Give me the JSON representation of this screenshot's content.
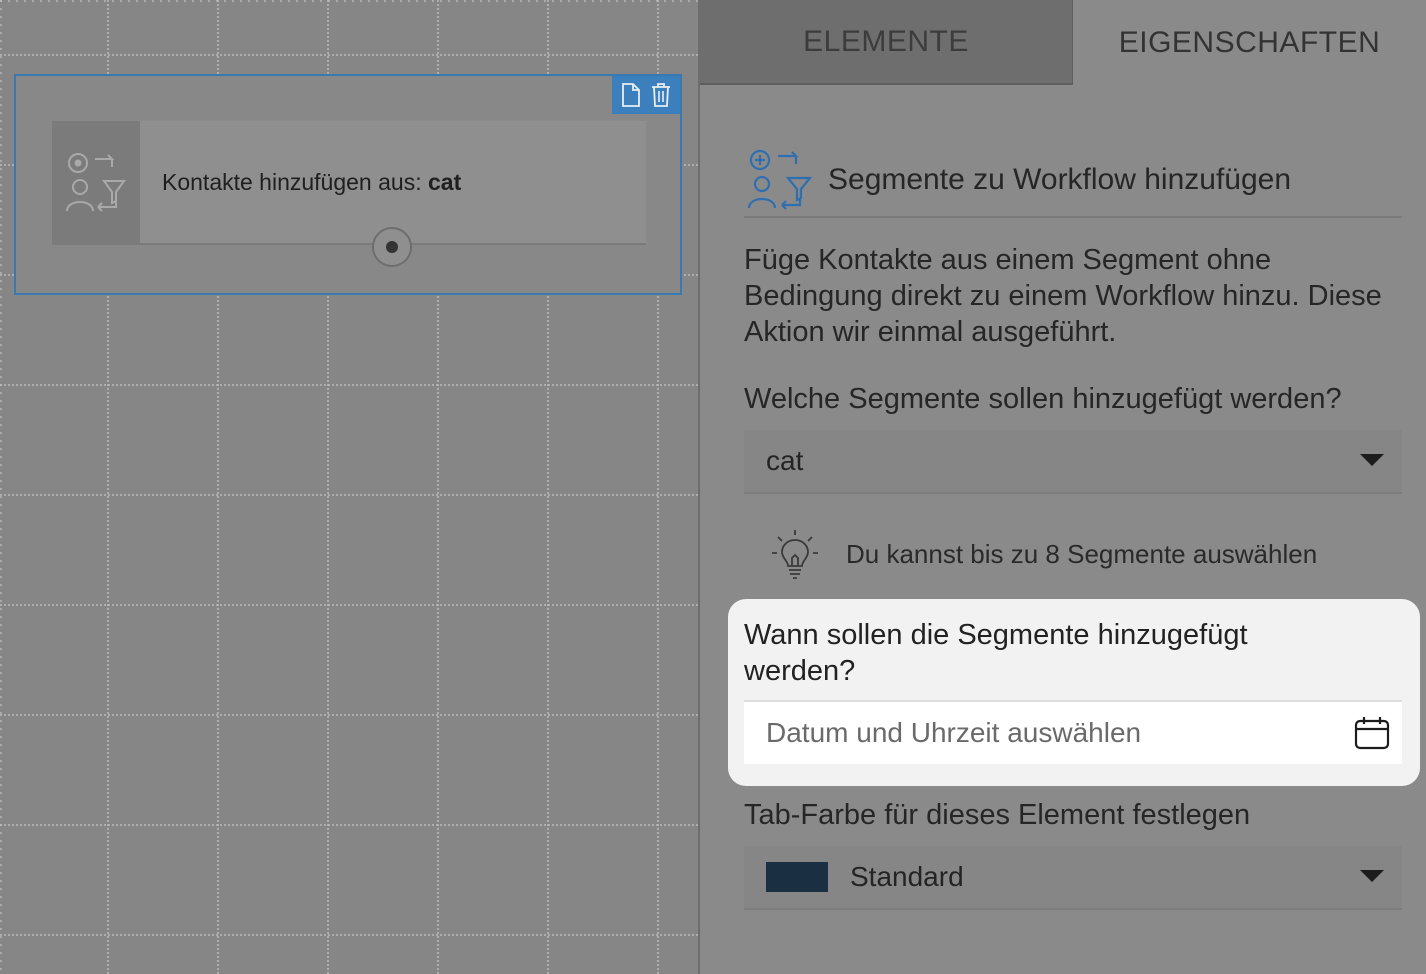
{
  "canvas": {
    "node": {
      "label_prefix": "Kontakte hinzufügen aus: ",
      "label_value": "cat",
      "toolbar": {
        "copy_icon": "document-icon",
        "delete_icon": "trash-icon"
      }
    }
  },
  "tabs": [
    {
      "label": "ELEMENTE",
      "active": false
    },
    {
      "label": "EIGENSCHAFTEN",
      "active": true
    }
  ],
  "properties": {
    "title": "Segmente zu Workflow hinzufügen",
    "description": "Füge Kontakte aus einem Segment ohne Bedingung direkt zu einem Workflow hinzu. Diese Aktion wir einmal ausgeführt.",
    "segments_label": "Welche Segmente sollen hinzugefügt werden?",
    "segments_value": "cat",
    "hint": "Du kannst bis zu 8 Segmente auswählen",
    "date_label": "Wann sollen die Segmente hinzugefügt werden?",
    "date_placeholder": "Datum und Uhrzeit auswählen",
    "color_label": "Tab-Farbe für dieses Element festlegen",
    "color_value": "Standard",
    "color_swatch": "#1b2f42"
  },
  "colors": {
    "accent": "#3c7fbd",
    "overlay_highlight": "#f2f2f2"
  }
}
